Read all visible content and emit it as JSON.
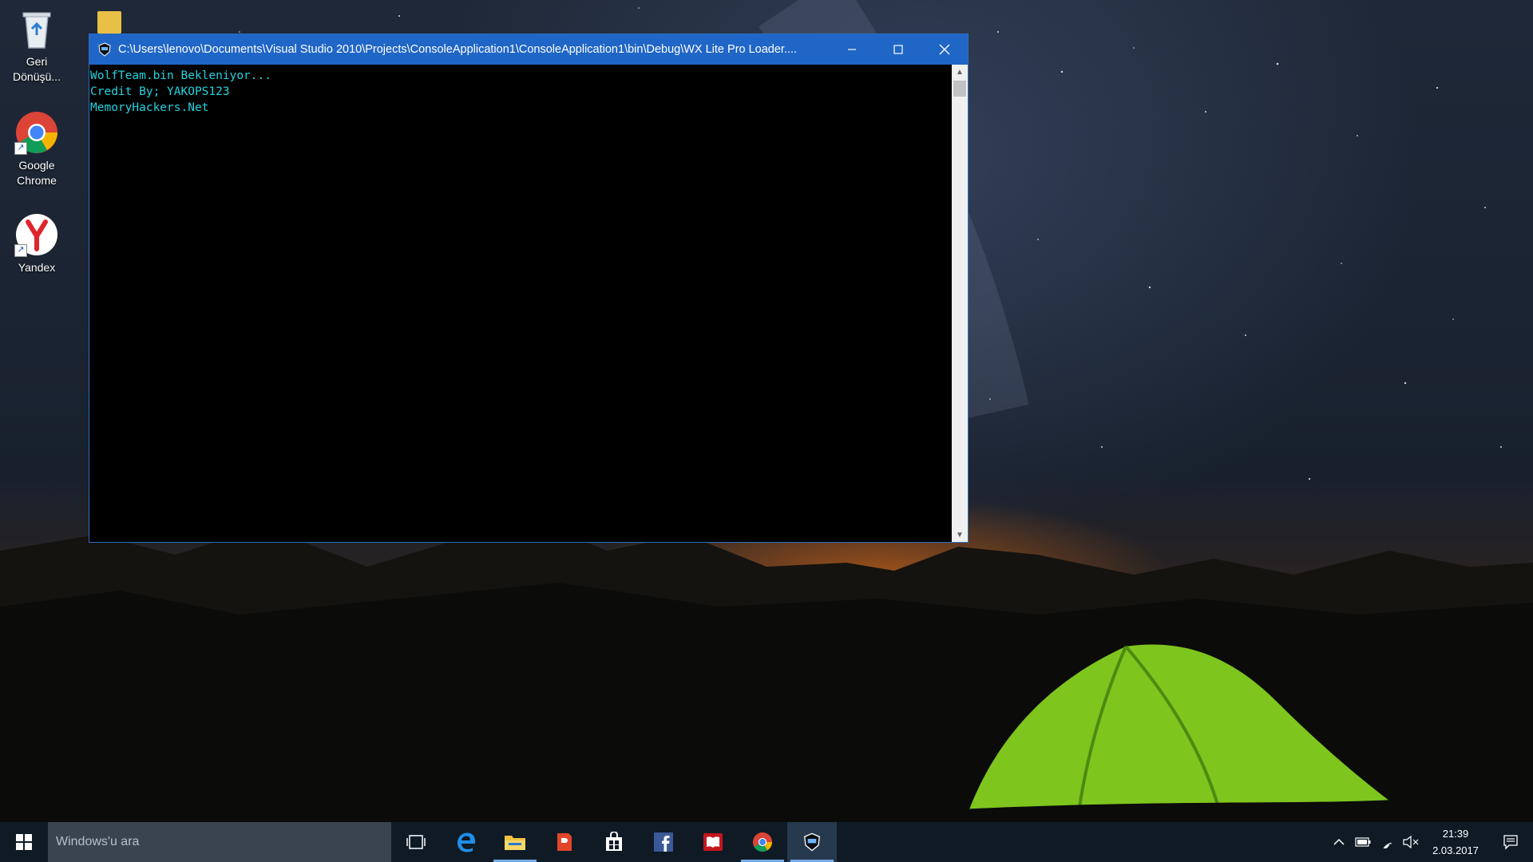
{
  "desktop": {
    "icons": [
      {
        "label": "Geri\nDönüşü...",
        "icon": "recycle-bin-icon"
      },
      {
        "label": "Google\nChrome",
        "icon": "chrome-icon"
      },
      {
        "label": "Yandex",
        "icon": "yandex-icon"
      }
    ]
  },
  "console": {
    "title": "C:\\Users\\lenovo\\Documents\\Visual Studio 2010\\Projects\\ConsoleApplication1\\ConsoleApplication1\\bin\\Debug\\WX Lite Pro Loader....",
    "lines": [
      "WolfTeam.bin Bekleniyor...",
      "Credit By; YAKOPS123",
      "MemoryHackers.Net"
    ],
    "text_color": "#22d3e0",
    "titlebar_color": "#1f66c7"
  },
  "taskbar": {
    "search_placeholder": "Windows'u ara",
    "apps": [
      "task-view-icon",
      "edge-icon",
      "file-explorer-icon",
      "app-icon",
      "store-icon",
      "facebook-icon",
      "reader-icon",
      "chrome-icon",
      "console-app-icon"
    ],
    "time": "21:39",
    "date": "2.03.2017"
  }
}
